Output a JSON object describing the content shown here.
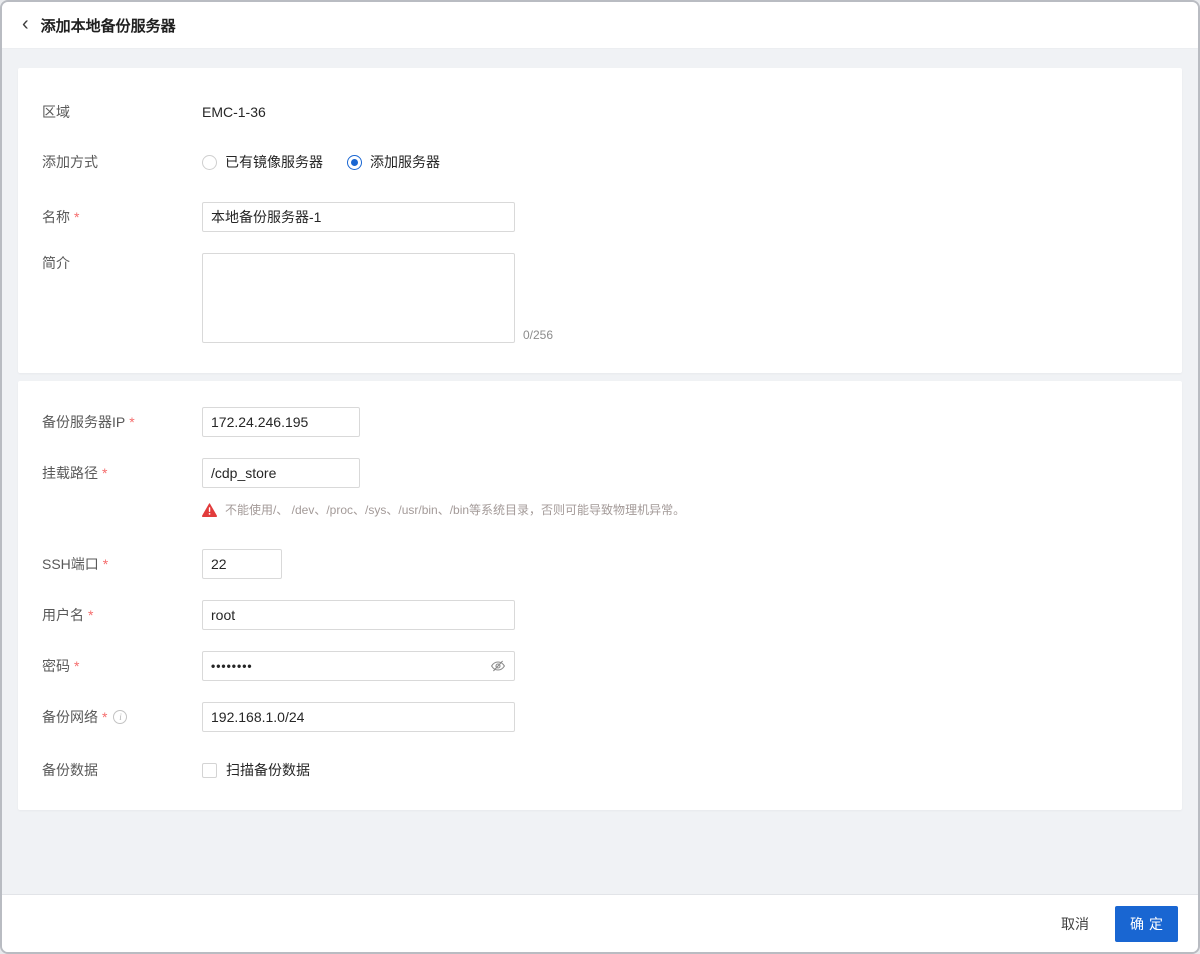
{
  "header": {
    "back_glyph": "‹",
    "title": "添加本地备份服务器"
  },
  "form": {
    "region": {
      "label": "区域",
      "value": "EMC-1-36"
    },
    "add_method": {
      "label": "添加方式",
      "options": [
        {
          "label": "已有镜像服务器",
          "selected": false
        },
        {
          "label": "添加服务器",
          "selected": true
        }
      ]
    },
    "name": {
      "label": "名称",
      "required": "*",
      "value": "本地备份服务器-1"
    },
    "description": {
      "label": "简介",
      "value": "",
      "counter": "0/256"
    },
    "server_ip": {
      "label": "备份服务器IP",
      "required": "*",
      "value": "172.24.246.195"
    },
    "mount_path": {
      "label": "挂载路径",
      "required": "*",
      "value": "/cdp_store",
      "warning": "不能使用/、 /dev、/proc、/sys、/usr/bin、/bin等系统目录，否则可能导致物理机异常。"
    },
    "ssh_port": {
      "label": "SSH端口",
      "required": "*",
      "value": "22"
    },
    "username": {
      "label": "用户名",
      "required": "*",
      "value": "root"
    },
    "password": {
      "label": "密码",
      "required": "*",
      "value": "••••••••"
    },
    "backup_network": {
      "label": "备份网络",
      "required": "*",
      "info_glyph": "i",
      "value": "192.168.1.0/24"
    },
    "backup_data": {
      "label": "备份数据",
      "checkbox_label": "扫描备份数据",
      "checked": false
    }
  },
  "footer": {
    "cancel_label": "取消",
    "confirm_label": "确定"
  },
  "colors": {
    "primary_blue": "#1966d2",
    "danger_red": "#e23c3c",
    "required_red": "#f56c6c",
    "page_background": "#f0f2f5"
  }
}
